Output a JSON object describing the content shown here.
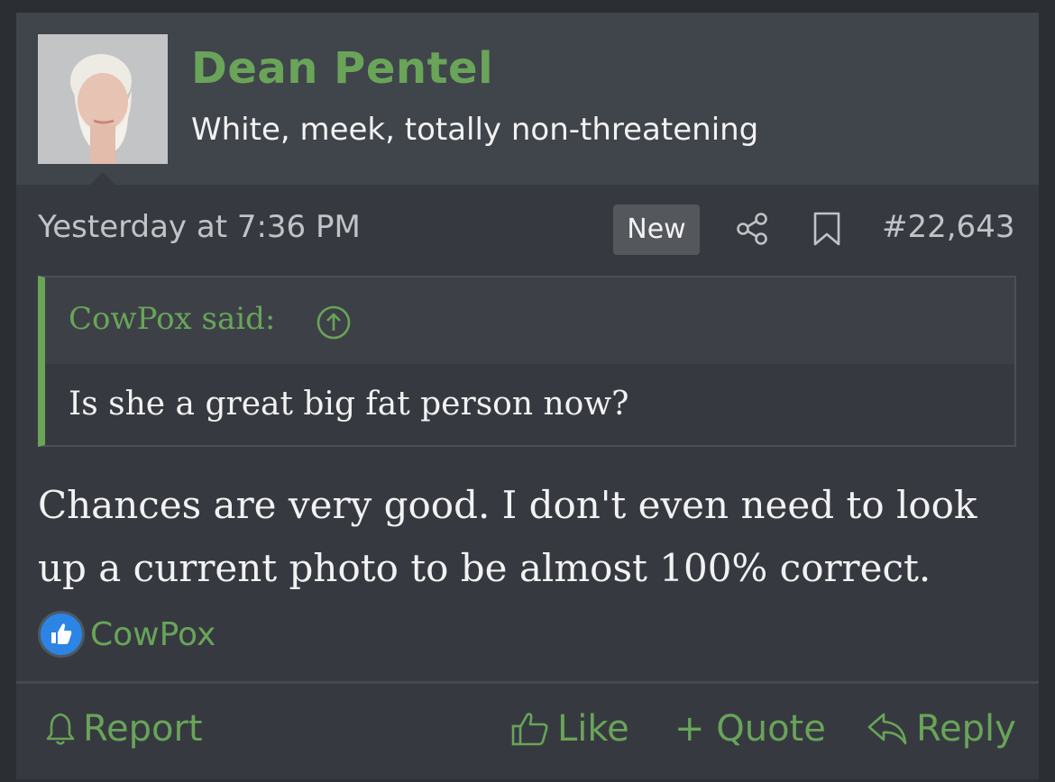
{
  "post": {
    "author": "Dean Pentel",
    "user_title": "White, meek, totally non-threatening",
    "timestamp": "Yesterday at 7:36 PM",
    "badge": "New",
    "post_number": "#22,643",
    "quote": {
      "author": "CowPox said:",
      "text": "Is she a great big fat person now?"
    },
    "body": "Chances are very good. I don't even need to look up a current photo to be almost 100% correct.",
    "reaction": {
      "icon": "thumbs-up-icon",
      "user": "CowPox"
    }
  },
  "actions": {
    "report": "Report",
    "like": "Like",
    "quote": "+ Quote",
    "reply": "Reply"
  },
  "colors": {
    "accent": "#69a459",
    "background": "#363a40",
    "userbar": "#40444b",
    "text": "#f2f2f2",
    "muted": "#c1c3c6"
  }
}
